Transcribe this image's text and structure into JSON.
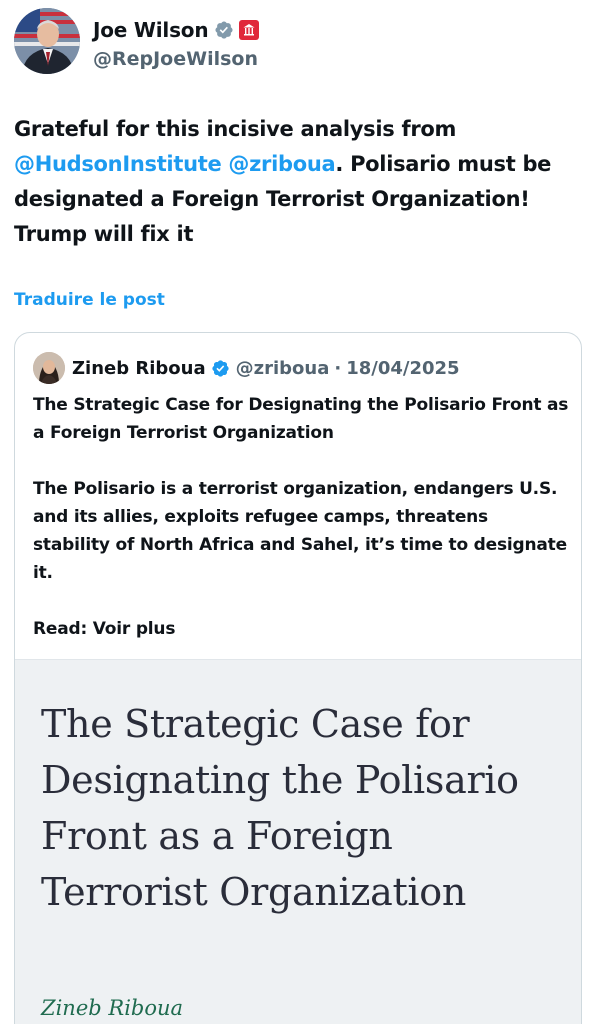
{
  "tweet": {
    "author": {
      "name": "Joe Wilson",
      "handle": "@RepJoeWilson"
    },
    "text": {
      "part1": "Grateful for this incisive analysis from ",
      "mention1": "@HudsonInstitute",
      "space": " ",
      "mention2": "@zriboua",
      "part2": ". Polisario must be designated a Foreign Terrorist Organization! Trump will fix it"
    },
    "translate_label": "Traduire le post"
  },
  "quote": {
    "author": {
      "name": "Zineb Riboua",
      "handle": "@zriboua",
      "separator": "·",
      "date": "18/04/2025"
    },
    "title": "The Strategic Case for Designating the Polisario Front as a Foreign Terrorist Organization",
    "body": "The Polisario is a terrorist organization, endangers U.S. and its allies, exploits refugee camps, threatens stability of North Africa and Sahel, it’s time to designate it.",
    "read_label": "Read:",
    "more_label": "Voir plus",
    "preview": {
      "title": "The Strategic Case for Designating the Polisario Front as a Foreign Terrorist Organization",
      "author": "Zineb Riboua"
    }
  },
  "colors": {
    "link": "#1d9bf0",
    "secondary_text": "#536471",
    "gov_badge": "#e0273a",
    "verified_gray": "#829aab",
    "verified_blue": "#1d9bf0",
    "preview_author": "#1f6b4f"
  },
  "icons": {
    "author_verified": "verified-gray-icon",
    "author_affiliation": "government-badge-icon",
    "quote_verified": "verified-blue-icon"
  }
}
